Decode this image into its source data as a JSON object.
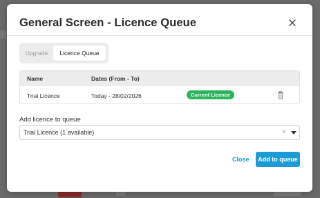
{
  "modal": {
    "title": "General Screen - Licence Queue",
    "close_icon": "close-icon"
  },
  "tabs": [
    {
      "label": "Upgrade",
      "active": false
    },
    {
      "label": "Licence Queue",
      "active": true
    }
  ],
  "table": {
    "columns": [
      "Name",
      "Dates (From - To)"
    ],
    "rows": [
      {
        "name": "Trial Licence",
        "dates": "Today - 28/02/2026",
        "status": "Current Licence",
        "action_icon": "trash-icon"
      }
    ]
  },
  "add_queue": {
    "label": "Add licence to queue",
    "selected": "Trial Licence (1 available)",
    "clear_icon": "clear-icon",
    "caret_icon": "chevron-down-icon"
  },
  "footer": {
    "close_label": "Close",
    "add_label": "Add to queue"
  },
  "colors": {
    "primary": "#1a9bd6",
    "success": "#2db55d",
    "overlay": "#6b6b6b"
  }
}
